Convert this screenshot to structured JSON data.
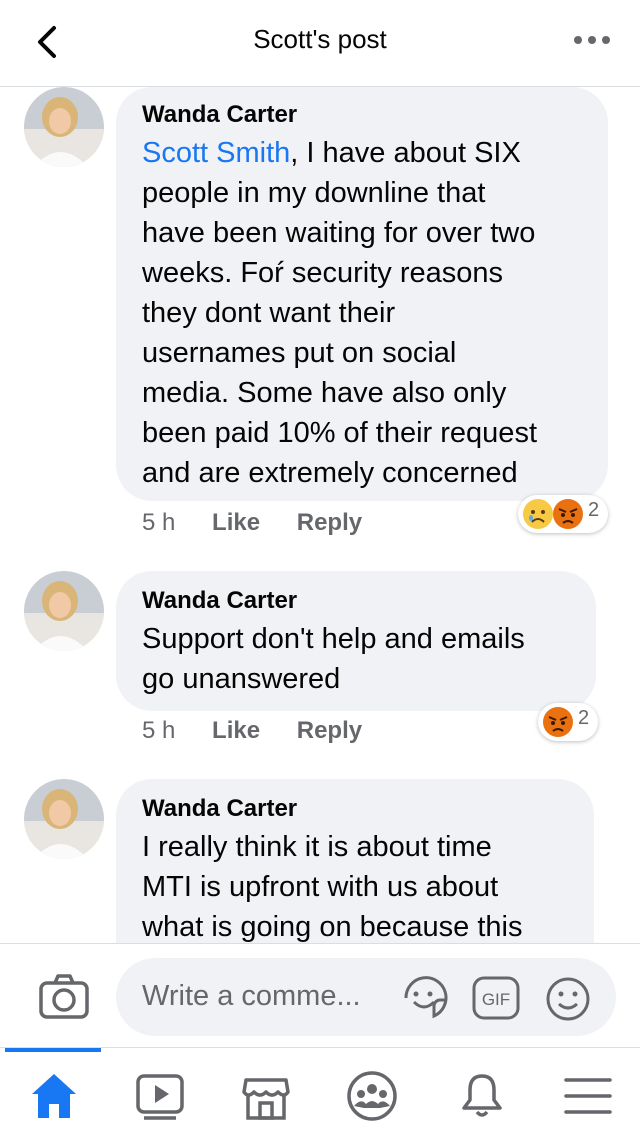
{
  "header": {
    "title": "Scott's post",
    "back_icon": "chevron-left-icon",
    "more_icon": "more-horizontal-icon"
  },
  "comments": [
    {
      "author": "Wanda Carter",
      "mention": "Scott Smith",
      "text_lines": ", I have about SIX\npeople in my downline that\nhave been waiting for over two\nweeks. Foŕ security reasons\nthey dont want their\nusernames put on social\nmedia. Some have also only\nbeen paid 10% of their request\nand are extremely concerned",
      "time": "5 h",
      "like_label": "Like",
      "reply_label": "Reply",
      "reactions": [
        "sad-emoji-icon",
        "angry-emoji-icon"
      ],
      "reaction_count": "2"
    },
    {
      "author": "Wanda Carter",
      "text": "Support don't help and emails\ngo unanswered",
      "time": "5 h",
      "like_label": "Like",
      "reply_label": "Reply",
      "reactions": [
        "angry-emoji-icon"
      ],
      "reaction_count": "2"
    },
    {
      "author": "Wanda Carter",
      "text": "I really think it is about time\nMTI is upfront with us about\nwhat is going on because this"
    }
  ],
  "composer": {
    "placeholder": "Write a comme...",
    "camera_icon": "camera-icon",
    "sticker_icon": "sticker-icon",
    "gif_label": "GIF",
    "emoji_icon": "smiley-icon"
  },
  "tabbar": {
    "active": "home",
    "tabs": [
      "home-icon",
      "watch-icon",
      "marketplace-icon",
      "groups-icon",
      "notifications-icon",
      "menu-icon"
    ]
  },
  "colors": {
    "accent": "#1877f2",
    "bubble": "#f0f2f5",
    "secondary_text": "#65676b"
  }
}
